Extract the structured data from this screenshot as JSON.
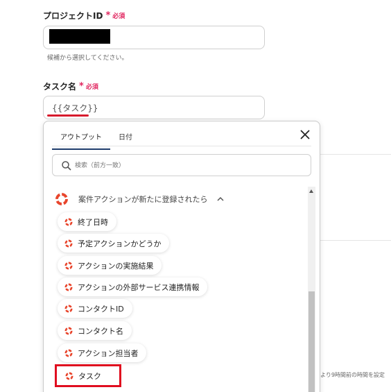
{
  "project_field": {
    "label": "プロジェクトID",
    "required_mark": "*",
    "required_text": "必須",
    "hint": "候補から選択してください。"
  },
  "task_field": {
    "label": "タスク名",
    "required_mark": "*",
    "required_text": "必須",
    "value": "{{タスク}}"
  },
  "picker": {
    "tabs": [
      "アウトプット",
      "日付"
    ],
    "active_tab": "アウトプット",
    "search_placeholder": "検索（前方一致）",
    "group_title": "案件アクションが新たに登録されたら",
    "items": [
      "終了日時",
      "予定アクションかどうか",
      "アクションの実施結果",
      "アクションの外部サービス連携情報",
      "コンタクトID",
      "コンタクト名",
      "アクション担当者",
      "タスク"
    ],
    "selected_item": "タスク"
  },
  "background_text": "より9時間前の時間を設定",
  "colors": {
    "required": "#e0245e",
    "highlight": "#e00d1f",
    "icon": "#e8452c"
  }
}
